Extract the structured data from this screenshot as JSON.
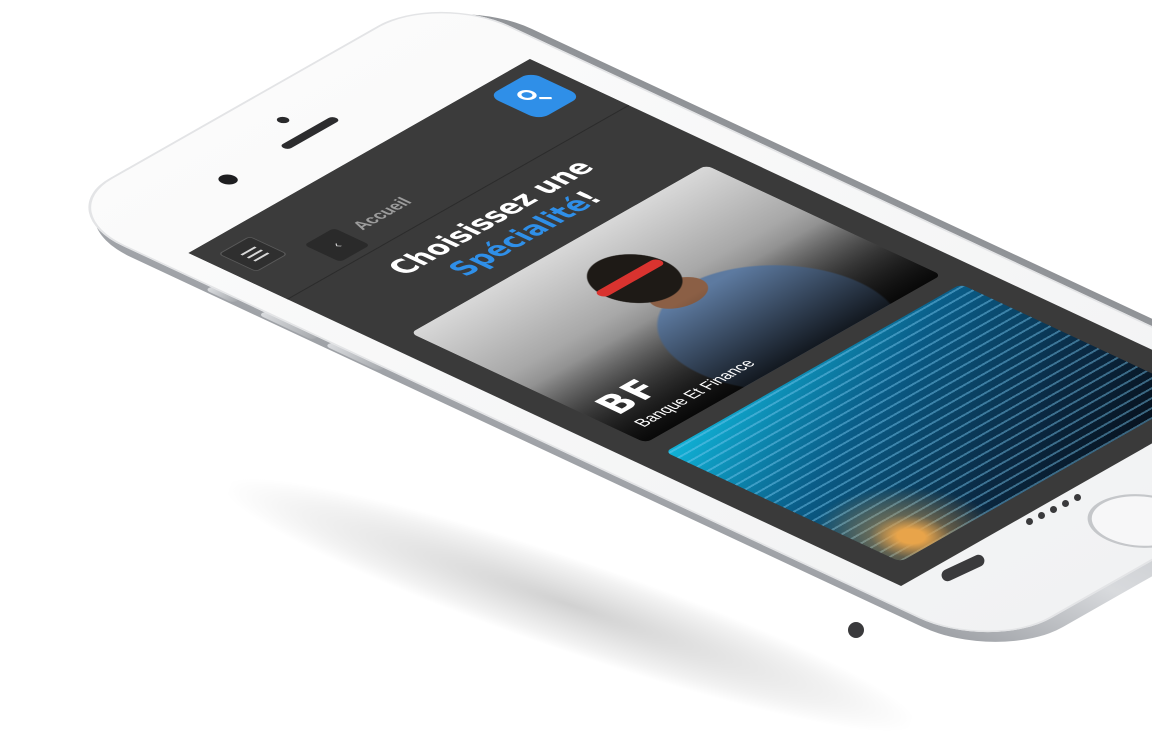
{
  "header": {
    "title": "Accueil",
    "back_label": "‹"
  },
  "heading": {
    "line1": "Choisissez une",
    "accent": "Spécialité",
    "suffix": "!"
  },
  "cards": [
    {
      "abbr": "BF",
      "name": "Banque Et Finance"
    }
  ],
  "colors": {
    "accent": "#2f8fe8",
    "screen_background": "#3a3a3a",
    "phone_body": "#f4f4f5"
  },
  "icons": {
    "menu": "hamburger-icon",
    "back": "chevron-left-icon",
    "search": "search-icon"
  }
}
